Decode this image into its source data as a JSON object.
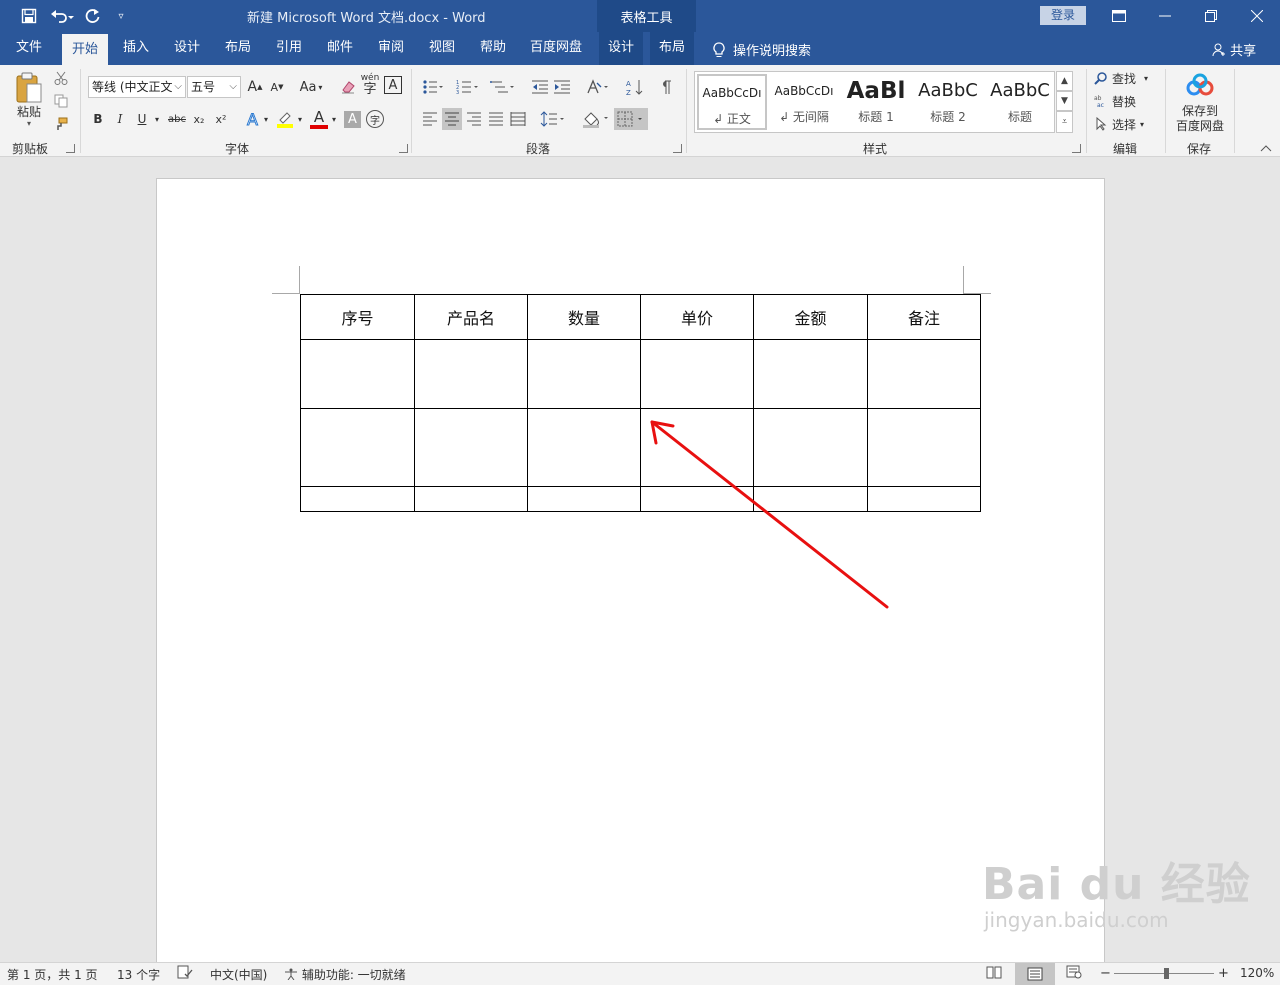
{
  "titlebar": {
    "doc_title": "新建 Microsoft Word 文档.docx  -  Word",
    "context_tab": "表格工具",
    "login": "登录"
  },
  "tabs": {
    "file": "文件",
    "home": "开始",
    "insert": "插入",
    "design": "设计",
    "layout": "布局",
    "references": "引用",
    "mailings": "邮件",
    "review": "审阅",
    "view": "视图",
    "help": "帮助",
    "baidu_netdisk": "百度网盘",
    "table_design": "设计",
    "table_layout": "布局",
    "tell_me": "操作说明搜索",
    "share": "共享"
  },
  "ribbon": {
    "clipboard": {
      "paste": "粘贴",
      "label": "剪贴板"
    },
    "font": {
      "font_name": "等线 (中文正文)",
      "font_size": "五号",
      "label": "字体",
      "grow": "A",
      "shrink": "A",
      "case": "Aa",
      "bold": "B",
      "italic": "I",
      "underline": "U",
      "strike": "abc",
      "subscript": "x₂",
      "superscript": "x²",
      "font_color_letter": "A",
      "char_shading": "A",
      "enclose": "字",
      "phonetic": "wén",
      "border_char": "A",
      "highlight_color": "#ffff00",
      "font_color": "#e00000"
    },
    "paragraph": {
      "label": "段落"
    },
    "styles": {
      "label": "样式",
      "items": [
        {
          "sample": "AaBbCcDı",
          "name": "↲ 正文"
        },
        {
          "sample": "AaBbCcDı",
          "name": "↲ 无间隔"
        },
        {
          "sample": "AaBl",
          "name": "标题 1"
        },
        {
          "sample": "AaBbC",
          "name": "标题 2"
        },
        {
          "sample": "AaBbC",
          "name": "标题"
        }
      ]
    },
    "editing": {
      "find": "查找",
      "replace": "替换",
      "select": "选择",
      "label": "编辑"
    },
    "save": {
      "line1": "保存到",
      "line2": "百度网盘",
      "label": "保存"
    }
  },
  "table": {
    "headers": [
      "序号",
      "产品名",
      "数量",
      "单价",
      "金额",
      "备注"
    ]
  },
  "watermark": {
    "brand": "Bai du 经验",
    "site": "jingyan.baidu.com"
  },
  "statusbar": {
    "page": "第 1 页，共 1 页",
    "words": "13 个字",
    "language": "中文(中国)",
    "accessibility": "辅助功能: 一切就绪",
    "zoom": "120%",
    "zoom_level_fraction": 0.52
  },
  "colors": {
    "accent": "#2b579a",
    "arrow": "#e81010"
  }
}
